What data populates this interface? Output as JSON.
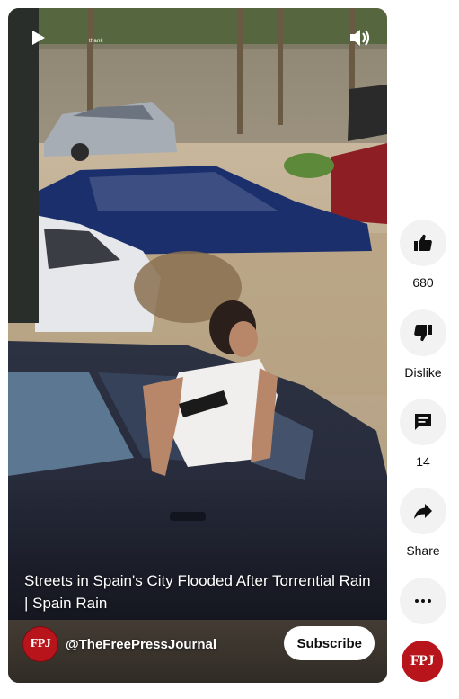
{
  "video": {
    "progress_label": "thank",
    "title": "Streets in Spain's City Flooded After Torrential Rain | Spain Rain",
    "channel_avatar_text": "FPJ",
    "channel_handle": "@TheFreePressJournal",
    "subscribe_label": "Subscribe",
    "play_icon": "play-icon",
    "volume_icon": "volume-icon"
  },
  "actions": {
    "like": {
      "icon": "thumbs-up-icon",
      "label": "680"
    },
    "dislike": {
      "icon": "thumbs-down-icon",
      "label": "Dislike"
    },
    "comments": {
      "icon": "comment-icon",
      "label": "14"
    },
    "share": {
      "icon": "share-icon",
      "label": "Share"
    },
    "more": {
      "icon": "more-horizontal-icon"
    }
  },
  "sidebar_avatar_text": "FPJ",
  "colors": {
    "brand_red": "#b8141b",
    "button_bg": "#f2f2f2",
    "text": "#0f0f0f"
  }
}
